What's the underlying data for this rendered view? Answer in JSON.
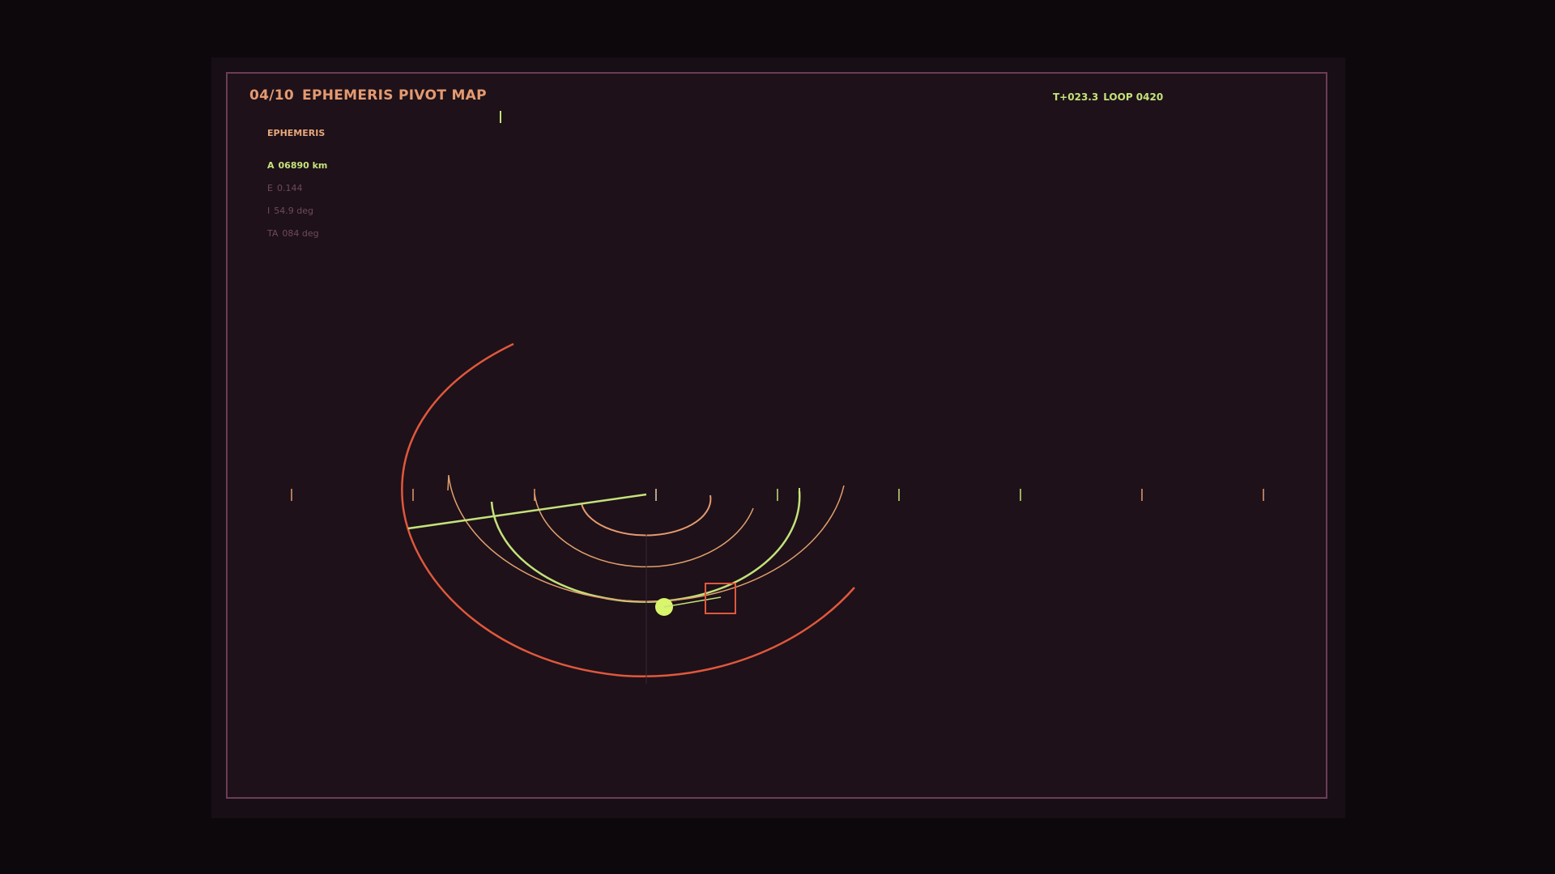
{
  "header": {
    "index": "04/10",
    "title": "EPHEMERIS PIVOT MAP",
    "clock": "T+023.3",
    "loop": "LOOP 0420"
  },
  "ephemeris": {
    "label": "EPHEMERIS",
    "params": [
      {
        "key": "A",
        "value": "06890 km"
      },
      {
        "key": "E",
        "value": "0.144"
      },
      {
        "key": "I",
        "value": "54.9 deg"
      },
      {
        "key": "TA",
        "value": "084 deg"
      }
    ]
  },
  "colors": {
    "accent_orange": "#e49a70",
    "accent_lime": "#c3e27a",
    "accent_red": "#e0583c",
    "muted": "#6e4a5e",
    "frame": "#6b3c58",
    "background": "#1e1119"
  }
}
